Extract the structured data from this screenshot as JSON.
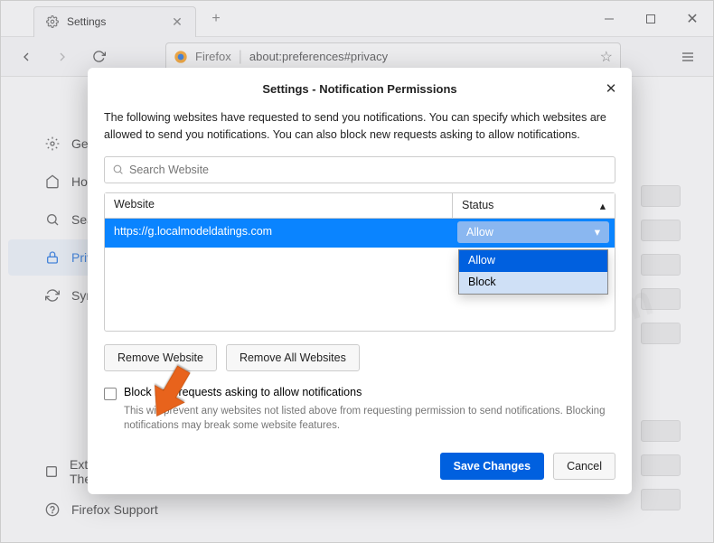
{
  "window": {
    "tab_title": "Settings",
    "url_prefix": "Firefox",
    "url": "about:preferences#privacy"
  },
  "sidebar": {
    "items": [
      {
        "label": "General"
      },
      {
        "label": "Home"
      },
      {
        "label": "Search"
      },
      {
        "label": "Privacy & Security"
      },
      {
        "label": "Sync"
      }
    ],
    "bottom": [
      {
        "label": "Extensions & Themes"
      },
      {
        "label": "Firefox Support"
      }
    ]
  },
  "modal": {
    "title": "Settings - Notification Permissions",
    "description": "The following websites have requested to send you notifications. You can specify which websites are allowed to send you notifications. You can also block new requests asking to allow notifications.",
    "search_placeholder": "Search Website",
    "col_website": "Website",
    "col_status": "Status",
    "row_site": "https://g.localmodeldatings.com",
    "row_status": "Allow",
    "dropdown_options": [
      "Allow",
      "Block"
    ],
    "remove_website": "Remove Website",
    "remove_all": "Remove All Websites",
    "block_checkbox": "Block new requests asking to allow notifications",
    "block_help": "This will prevent any websites not listed above from requesting permission to send notifications. Blocking notifications may break some website features.",
    "save": "Save Changes",
    "cancel": "Cancel"
  },
  "watermark": "pcrisk.com"
}
